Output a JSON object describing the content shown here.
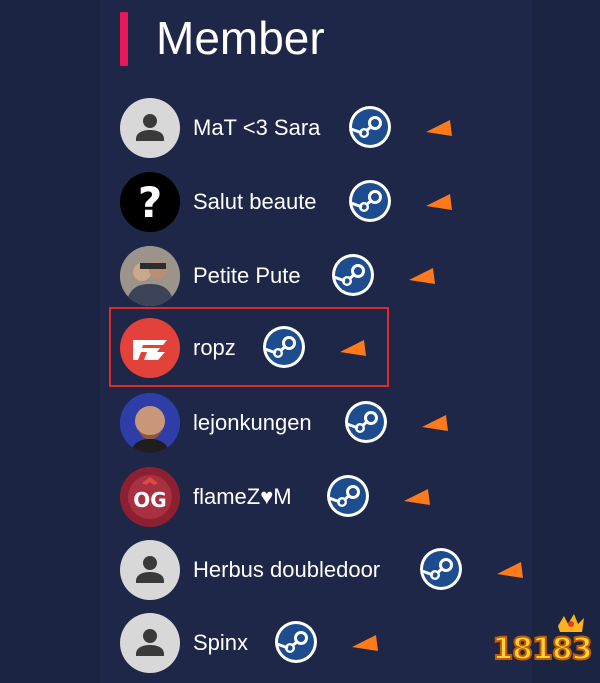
{
  "header": {
    "title": "Member"
  },
  "members": [
    {
      "name": "MaT <3 Sara",
      "avatar": "default-person-icon"
    },
    {
      "name": "Salut beaute",
      "avatar": "question-mark-icon"
    },
    {
      "name": "Petite Pute",
      "avatar": "photo-avatar"
    },
    {
      "name": "ropz",
      "avatar": "faze-logo-icon"
    },
    {
      "name": "lejonkungen",
      "avatar": "photo-avatar"
    },
    {
      "name": "flameZ♥M",
      "avatar": "og-logo-icon"
    },
    {
      "name": "Herbus doubledoor",
      "avatar": "default-person-icon"
    },
    {
      "name": "Spinx",
      "avatar": "default-person-icon"
    }
  ],
  "icons": {
    "platform": "steam-icon",
    "action": "orange-flag-icon"
  },
  "colors": {
    "accent": "#e8185a",
    "flag": "#ff7a1a",
    "highlight": "#e02a2a",
    "steam": "#1d4d8e"
  },
  "watermark": {
    "text": "18183"
  }
}
